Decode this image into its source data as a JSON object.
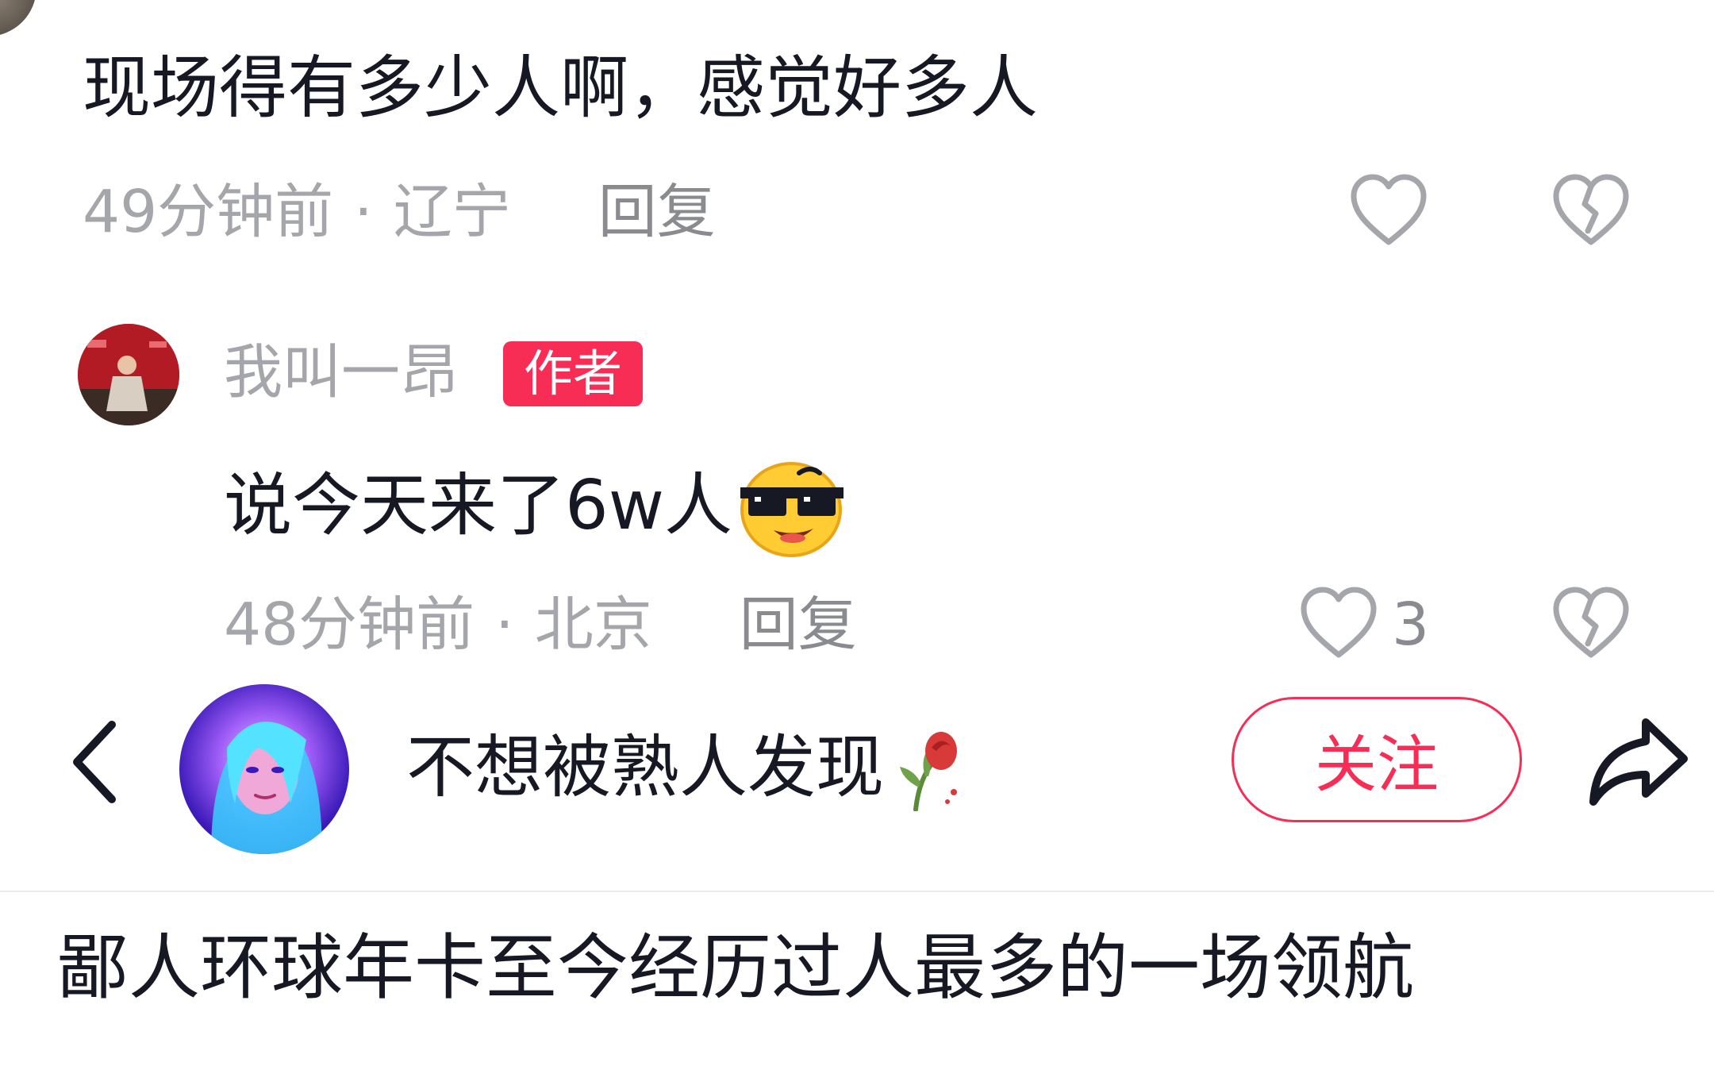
{
  "comments": [
    {
      "text": "现场得有多少人啊，感觉好多人",
      "time": "49分钟前",
      "separator": "·",
      "location": "辽宁",
      "reply_label": "回复"
    },
    {
      "username": "我叫一昂",
      "badge": "作者",
      "text": "说今天来了6w人",
      "emoji": "cool-sunglasses-emoji",
      "time": "48分钟前",
      "separator": "·",
      "location": "北京",
      "reply_label": "回复",
      "like_count": "3"
    }
  ],
  "header": {
    "username": "不想被熟人发现",
    "username_emoji": "wilted-rose-emoji",
    "follow_label": "关注"
  },
  "post": {
    "title": "鄙人环球年卡至今经历过人最多的一场领航"
  },
  "colors": {
    "accent": "#f72d55",
    "text_primary": "#161823",
    "text_secondary": "#a5a6ab"
  }
}
